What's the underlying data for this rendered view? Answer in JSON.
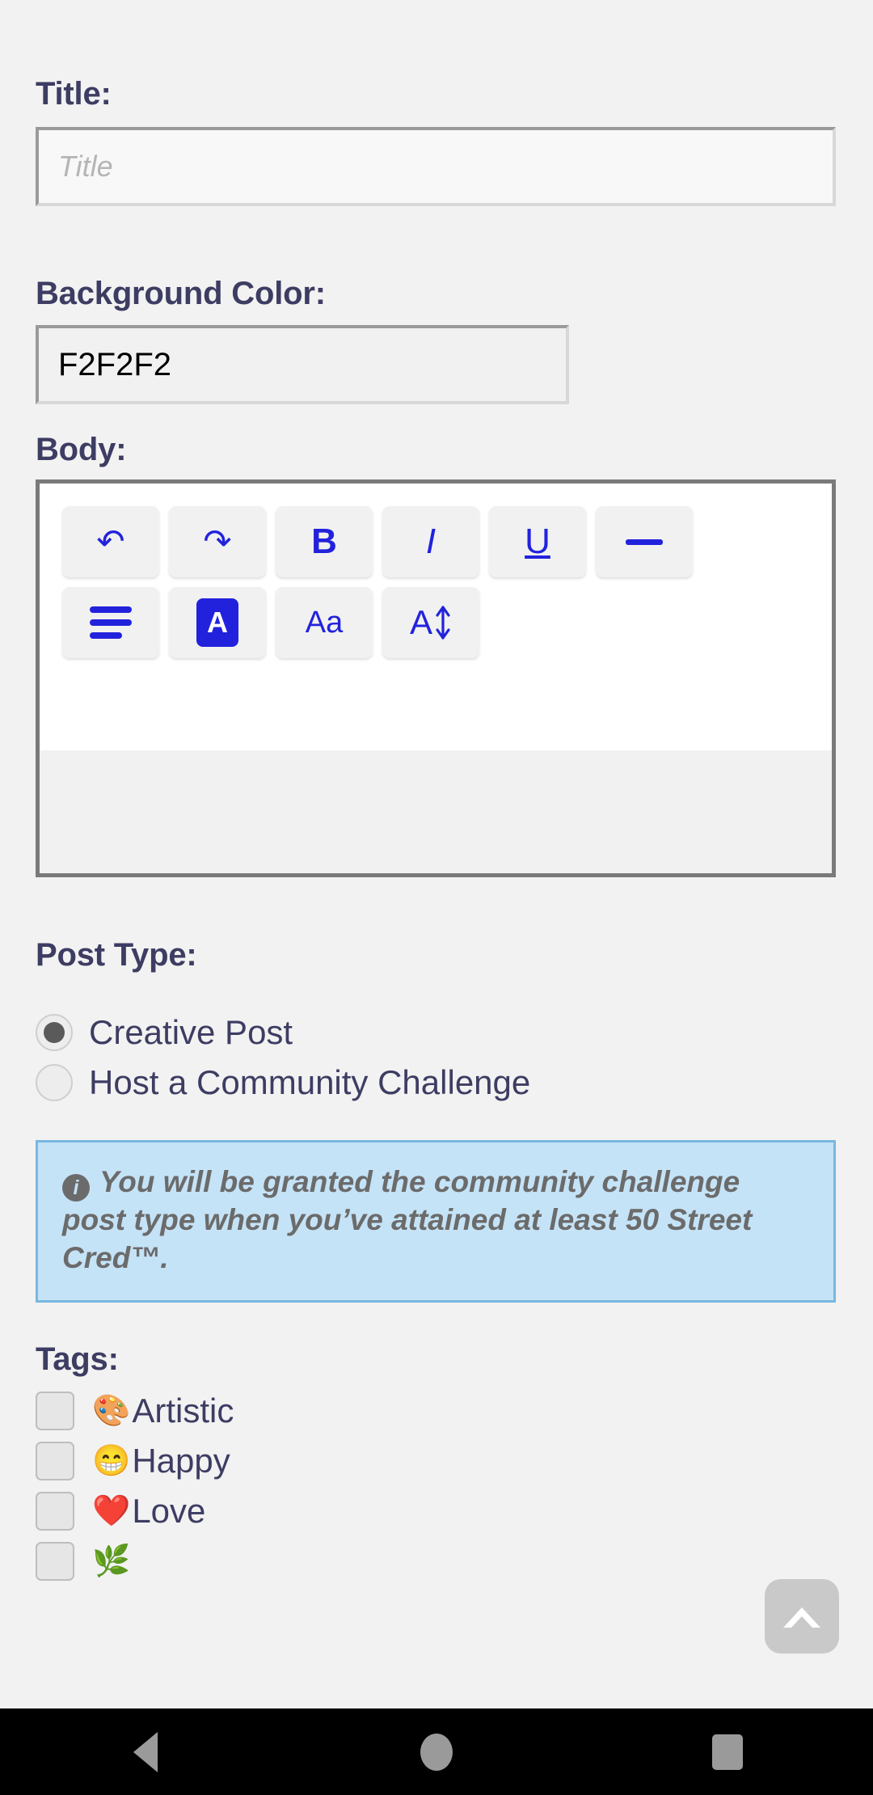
{
  "form": {
    "title": {
      "label": "Title:",
      "placeholder": "Title",
      "value": ""
    },
    "background_color": {
      "label": "Background Color:",
      "value": "F2F2F2"
    },
    "body": {
      "label": "Body:",
      "value": "",
      "toolbar": {
        "row1": [
          {
            "name": "undo",
            "icon": "undo-arrow-icon",
            "glyph": "↶"
          },
          {
            "name": "redo",
            "icon": "redo-arrow-icon",
            "glyph": "↷"
          },
          {
            "name": "bold",
            "icon": "bold-icon",
            "glyph": "B"
          },
          {
            "name": "italic",
            "icon": "italic-icon",
            "glyph": "I"
          },
          {
            "name": "underline",
            "icon": "underline-icon",
            "glyph": "U"
          },
          {
            "name": "strikethrough",
            "icon": "strikethrough-icon",
            "glyph": "—"
          }
        ],
        "row2": [
          {
            "name": "align",
            "icon": "align-lines-icon",
            "glyph": ""
          },
          {
            "name": "text-color",
            "icon": "text-color-a-icon",
            "glyph": "A"
          },
          {
            "name": "font",
            "icon": "font-family-icon",
            "glyph": "Aa"
          },
          {
            "name": "font-size",
            "icon": "font-size-icon",
            "glyph": "A"
          }
        ]
      }
    },
    "post_type": {
      "label": "Post Type:",
      "options": [
        {
          "label": "Creative Post",
          "selected": true
        },
        {
          "label": "Host a Community Challenge",
          "selected": false
        }
      ]
    },
    "info_banner": {
      "icon": "info-icon",
      "icon_glyph": "i",
      "text": "You will be granted the community challenge post type when you’ve attained at least 50 Street Cred™."
    },
    "tags": {
      "label": "Tags:",
      "items": [
        {
          "emoji": "🎨",
          "label": "Artistic",
          "checked": false
        },
        {
          "emoji": "😁",
          "label": "Happy",
          "checked": false
        },
        {
          "emoji": "❤️",
          "label": "Love",
          "checked": false
        },
        {
          "emoji": "🌿",
          "label": "",
          "checked": false
        }
      ]
    }
  },
  "floating": {
    "scroll_top": {
      "icon": "chevron-up-icon"
    }
  },
  "navbar": {
    "back": "back-triangle-icon",
    "home": "home-circle-icon",
    "recents": "recents-square-icon"
  },
  "colors": {
    "page_background": "#F2F2F2",
    "label_text": "#3D3D63",
    "accent_blue": "#2222DD",
    "banner_background": "#C5E3F7",
    "banner_border": "#79B7E0",
    "banner_text": "#6B6B6B"
  }
}
